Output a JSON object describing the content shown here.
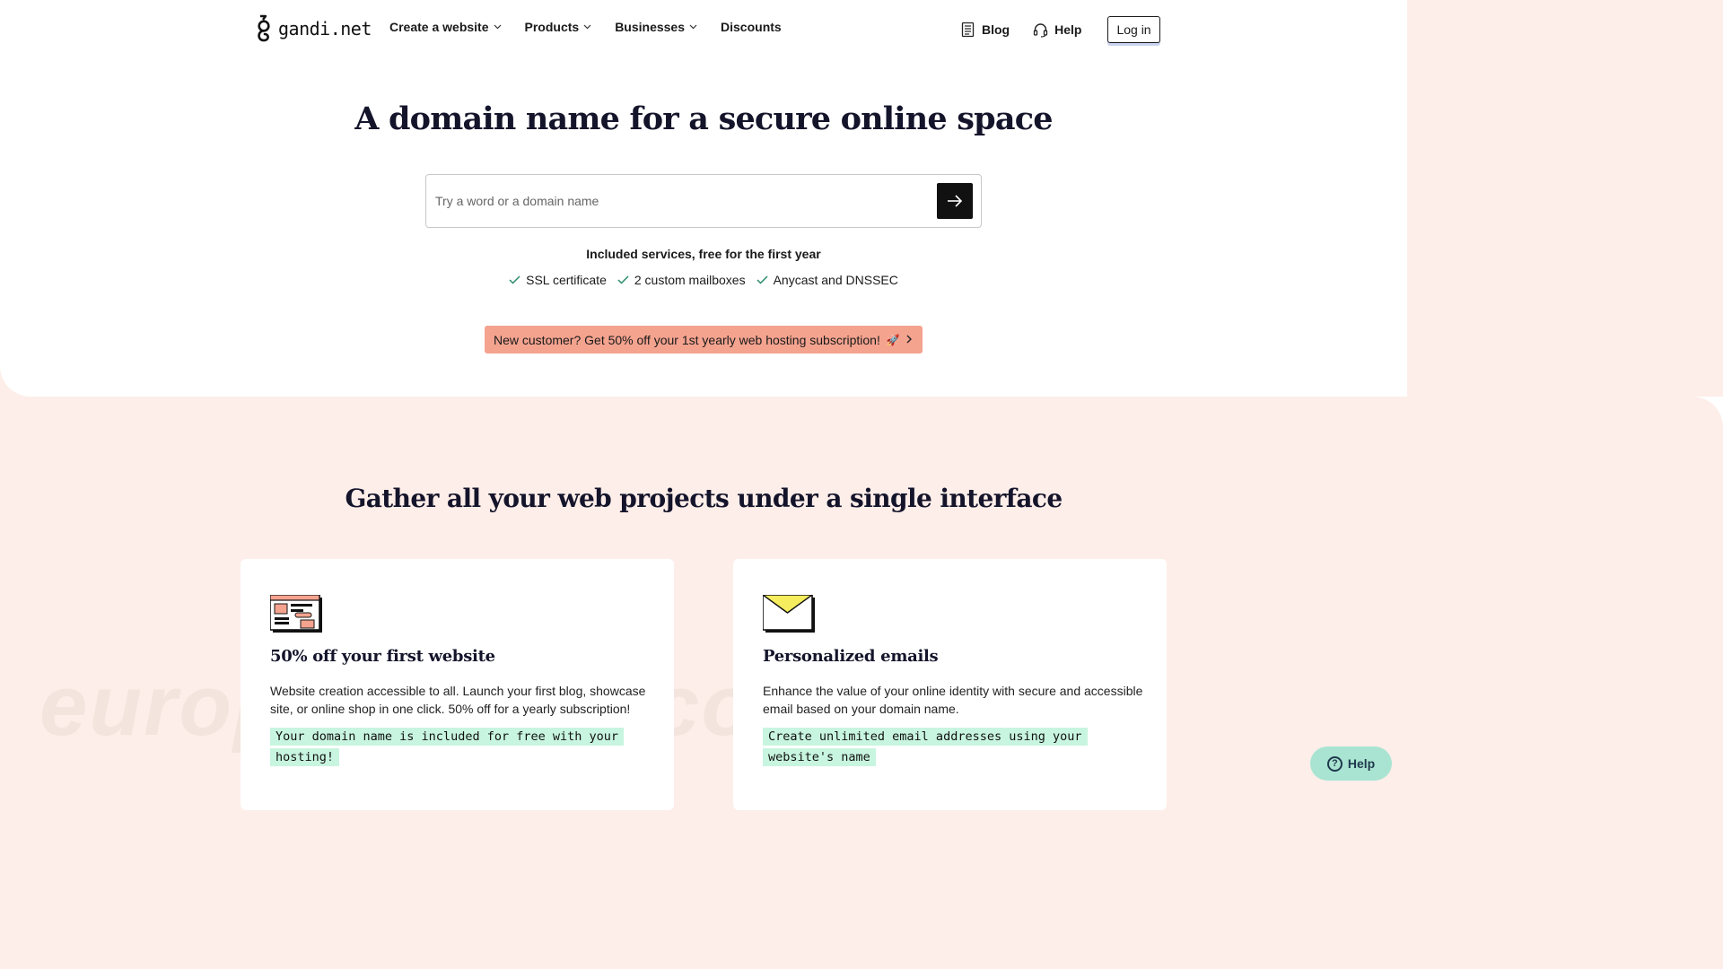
{
  "header": {
    "logo_text": "gandi.net",
    "nav": [
      {
        "label": "Create a website",
        "has_menu": true
      },
      {
        "label": "Products",
        "has_menu": true
      },
      {
        "label": "Businesses",
        "has_menu": true
      },
      {
        "label": "Discounts",
        "has_menu": false
      }
    ],
    "blog_label": "Blog",
    "help_label": "Help",
    "login_label": "Log in"
  },
  "hero": {
    "title": "A domain name for a secure online space",
    "search_placeholder": "Try a word or a domain name",
    "included_title": "Included services, free for the first year",
    "services": [
      "SSL certificate",
      "2 custom mailboxes",
      "Anycast and DNSSEC"
    ],
    "promo_text": "New customer? Get 50% off your 1st yearly web hosting subscription!",
    "promo_emoji": "🚀"
  },
  "projects": {
    "title": "Gather all your web projects under a single interface",
    "cards": [
      {
        "icon": "website-icon",
        "title": "50% off your first website",
        "text": "Website creation accessible to all. Launch your first blog, showcase site, or online shop in one click. 50% off for a yearly subscription!",
        "highlight": "Your domain name is included for free with your hosting!"
      },
      {
        "icon": "envelope-icon",
        "title": "Personalized emails",
        "text": "Enhance the value of your online identity with secure and accessible email based on your domain name.",
        "highlight": "Create unlimited email addresses using your website's name"
      }
    ]
  },
  "watermark": "europeantech.com",
  "help_fab_label": "Help",
  "colors": {
    "promo": "#f4a38f",
    "section_bg": "#fdeee9",
    "highlight": "#c8f5df",
    "help_fab": "#a9e4d2",
    "check": "#2a8a6a"
  }
}
